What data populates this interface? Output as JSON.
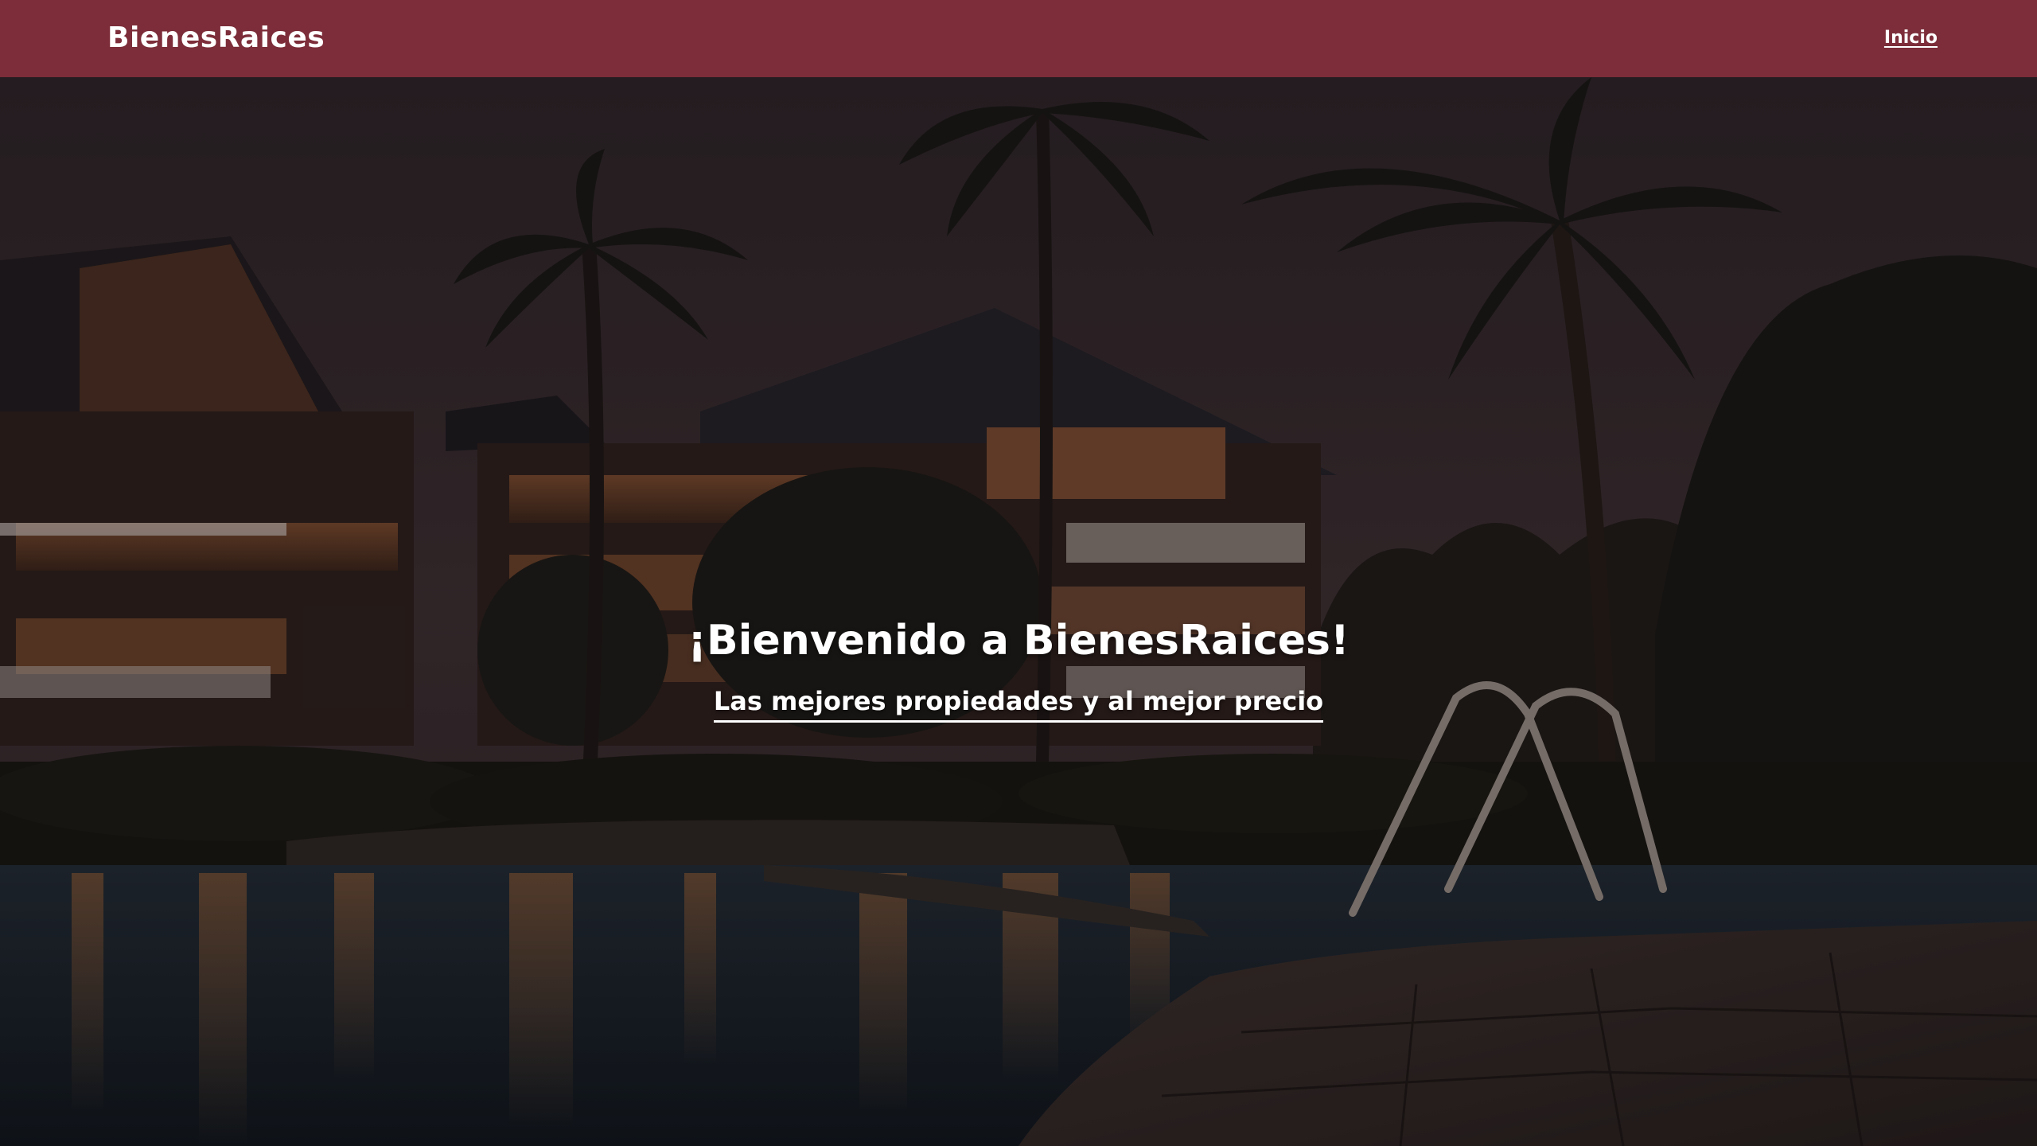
{
  "header": {
    "brand": "BienesRaices",
    "nav": [
      {
        "label": "Inicio"
      }
    ],
    "background_color": "#7c2d39"
  },
  "hero": {
    "title": "¡Bienvenido a BienesRaices!",
    "subtitle": "Las mejores propiedades y al mejor precio",
    "background": "night resort with palm trees and pool"
  }
}
